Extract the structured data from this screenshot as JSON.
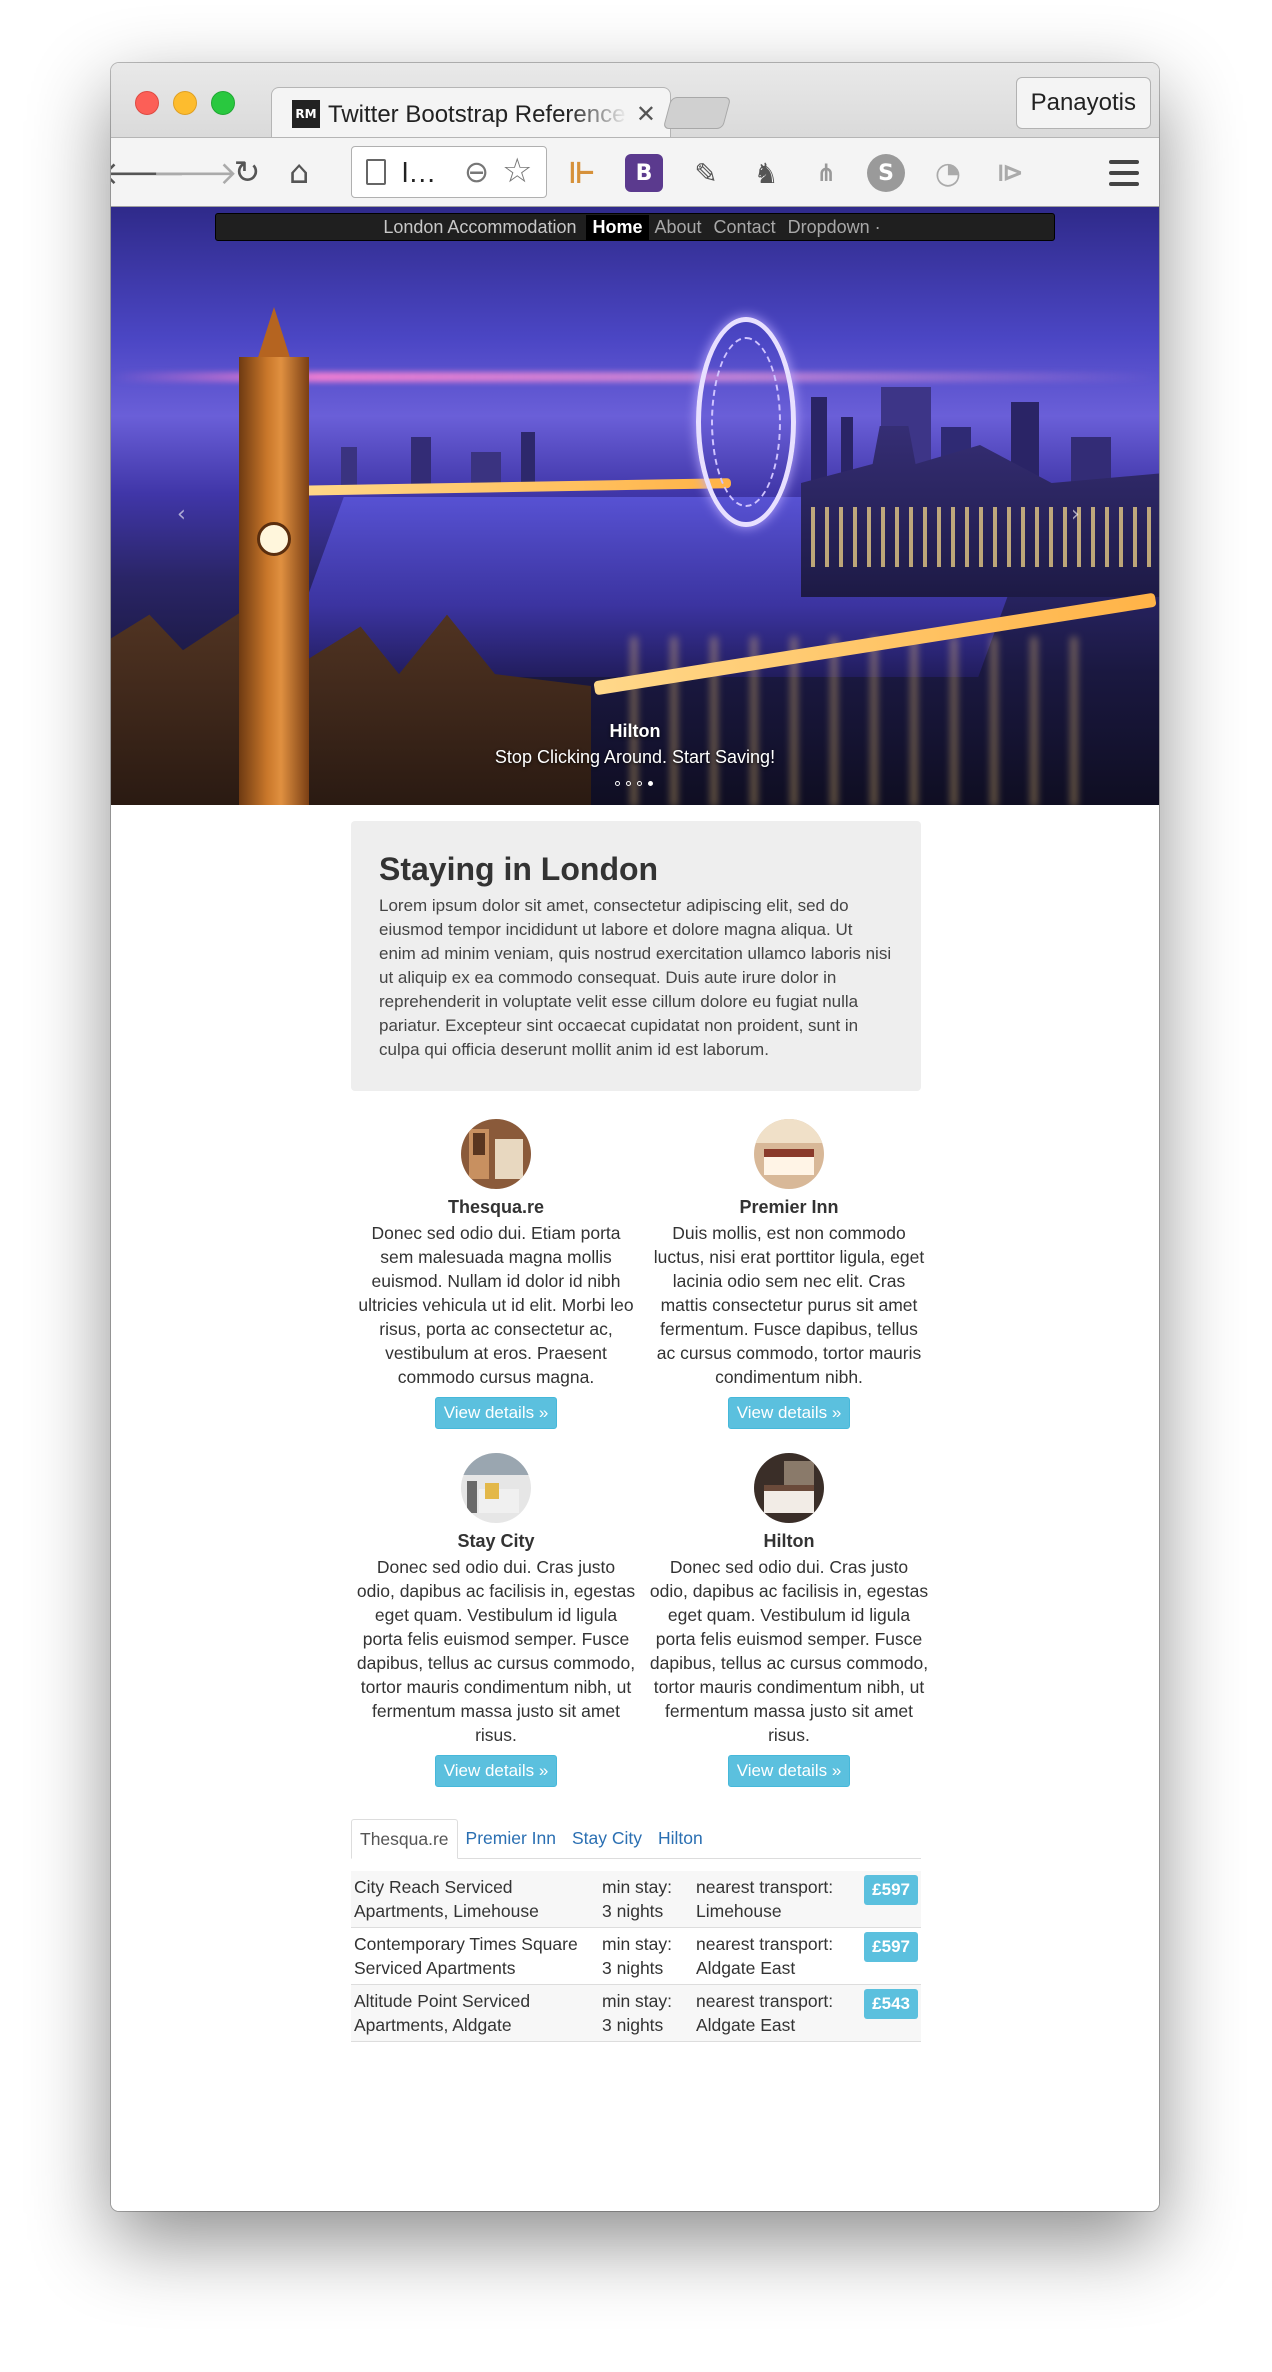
{
  "browser": {
    "tab_title": "Twitter Bootstrap Reference",
    "tab_favicon_text": "RM",
    "profile_name": "Panayotis",
    "address_text": "l…",
    "extensions": [
      "ruler-icon",
      "bootstrap-icon",
      "eyedropper-icon",
      "evernote-icon",
      "sitemap-icon",
      "skype-icon",
      "spinner-icon",
      "arrow-pair-icon"
    ],
    "extension_B_label": "B",
    "extension_S_label": "S"
  },
  "nav": {
    "brand": "London Accommodation",
    "links": [
      "Home",
      "About",
      "Contact",
      "Dropdown"
    ],
    "dropdown_caret": "·"
  },
  "hero": {
    "caption_title": "Hilton",
    "caption_text": "Stop Clicking Around. Start Saving!",
    "indicators": 4,
    "active_indicator": 4
  },
  "jumbotron": {
    "title": "Staying in London",
    "text": "Lorem ipsum dolor sit amet, consectetur adipiscing elit, sed do eiusmod tempor incididunt ut labore et dolore magna aliqua. Ut enim ad minim veniam, quis nostrud exercitation ullamco laboris nisi ut aliquip ex ea commodo consequat. Duis aute irure dolor in reprehenderit in voluptate velit esse cillum dolore eu fugiat nulla pariatur. Excepteur sint occaecat cupidatat non proident, sunt in culpa qui officia deserunt mollit anim id est laborum."
  },
  "hotels": [
    {
      "name": "Thesqua.re",
      "text": "Donec sed odio dui. Etiam porta sem malesuada magna mollis euismod. Nullam id dolor id nibh ultricies vehicula ut id elit. Morbi leo risus, porta ac consectetur ac, vestibulum at eros. Praesent commodo cursus magna.",
      "button": "View details »"
    },
    {
      "name": "Premier Inn",
      "text": "Duis mollis, est non commodo luctus, nisi erat porttitor ligula, eget lacinia odio sem nec elit. Cras mattis consectetur purus sit amet fermentum. Fusce dapibus, tellus ac cursus commodo, tortor mauris condimentum nibh.",
      "button": "View details »"
    },
    {
      "name": "Stay City",
      "text": "Donec sed odio dui. Cras justo odio, dapibus ac facilisis in, egestas eget quam. Vestibulum id ligula porta felis euismod semper. Fusce dapibus, tellus ac cursus commodo, tortor mauris condimentum nibh, ut fermentum massa justo sit amet risus.",
      "button": "View details »"
    },
    {
      "name": "Hilton",
      "text": "Donec sed odio dui. Cras justo odio, dapibus ac facilisis in, egestas eget quam. Vestibulum id ligula porta felis euismod semper. Fusce dapibus, tellus ac cursus commodo, tortor mauris condimentum nibh, ut fermentum massa justo sit amet risus.",
      "button": "View details »"
    }
  ],
  "tabs": [
    "Thesqua.re",
    "Premier Inn",
    "Stay City",
    "Hilton"
  ],
  "active_tab": "Thesqua.re",
  "listings": [
    {
      "name": "City Reach Serviced Apartments, Limehouse",
      "min_stay_label": "min stay:",
      "min_stay": "3 nights",
      "transport_label": "nearest transport:",
      "transport": "Limehouse",
      "price": "£597"
    },
    {
      "name": "Contemporary Times Square Serviced Apartments",
      "min_stay_label": "min stay:",
      "min_stay": "3 nights",
      "transport_label": "nearest transport:",
      "transport": "Aldgate East",
      "price": "£597"
    },
    {
      "name": "Altitude Point Serviced Apartments, Aldgate",
      "min_stay_label": "min stay:",
      "min_stay": "3 nights",
      "transport_label": "nearest transport:",
      "transport": "Aldgate East",
      "price": "£543"
    }
  ],
  "colors": {
    "info_button": "#5bc0de",
    "navbar": "#1f1f1f",
    "jumbotron_bg": "#eeeeee",
    "link": "#2a6fb2"
  }
}
